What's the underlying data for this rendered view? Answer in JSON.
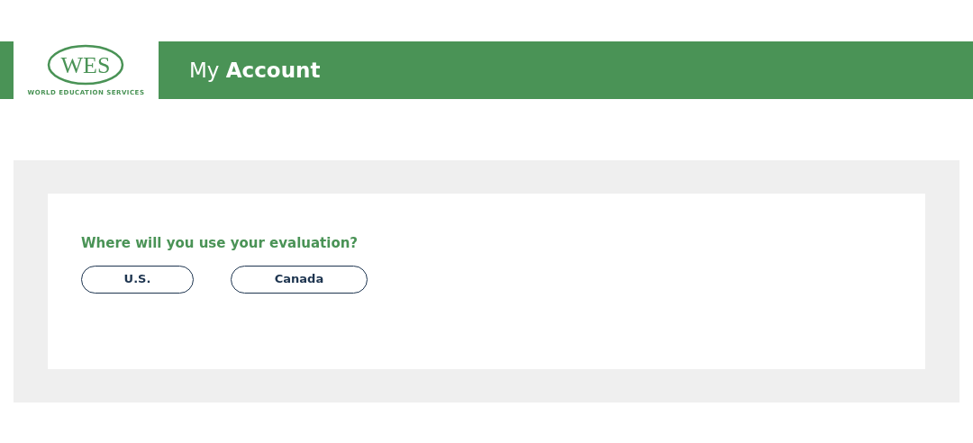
{
  "header": {
    "logo": {
      "mark": "WES",
      "tagline": "WORLD EDUCATION SERVICES"
    },
    "title": "My **Account**"
  },
  "question": {
    "text": "Where will you use your evaluation?",
    "options": [
      "U.S.",
      "Canada"
    ]
  }
}
